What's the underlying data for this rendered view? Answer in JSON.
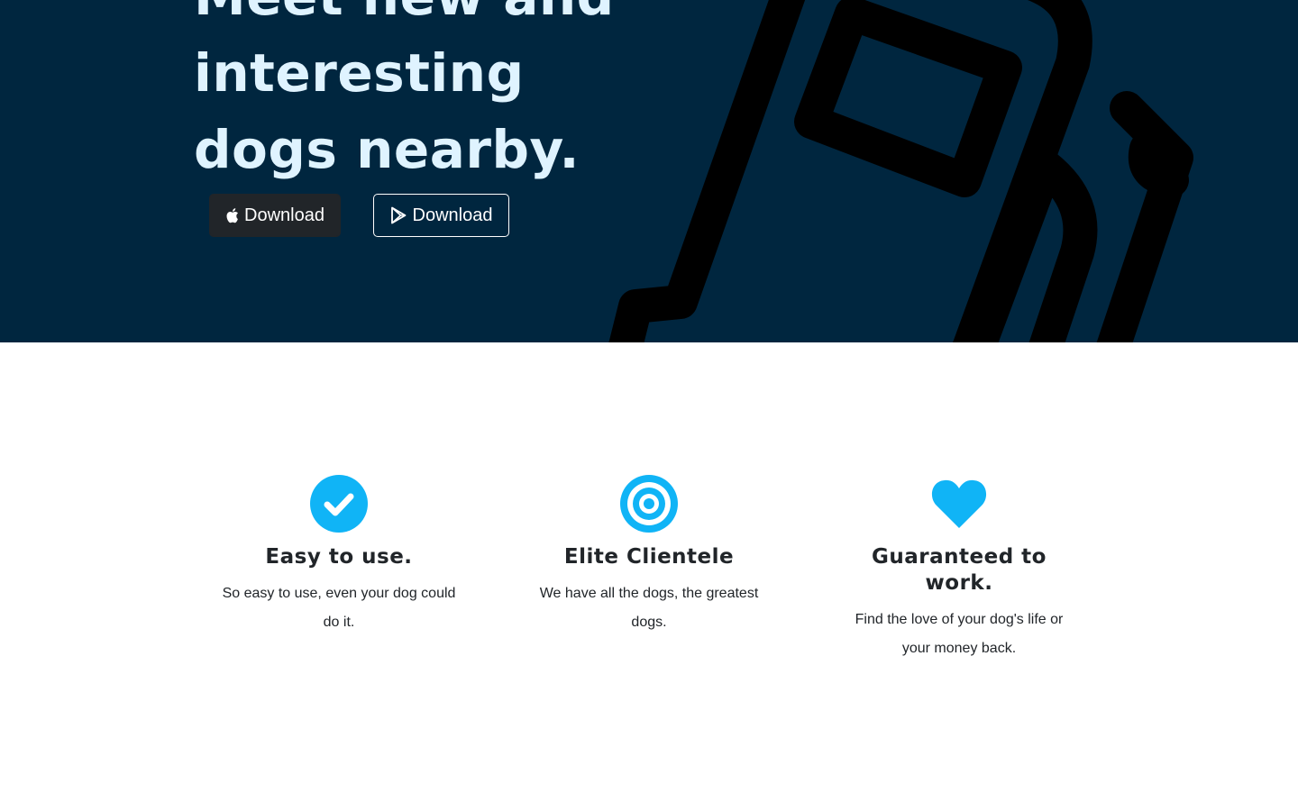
{
  "hero": {
    "headline_lines": [
      "Meet new and",
      "interesting",
      "dogs nearby."
    ],
    "apple_button": {
      "label": "Download",
      "icon": "apple-icon"
    },
    "play_button": {
      "label": "Download",
      "icon": "google-play-icon"
    },
    "background_color": "#00263f",
    "headline_color": "#dff3ff",
    "illustration": "phone-outline-illustration"
  },
  "features": [
    {
      "icon": "check-circle-icon",
      "title": "Easy to use.",
      "text": "So easy to use, even your dog could do it."
    },
    {
      "icon": "bullseye-icon",
      "title": "Elite Clientele",
      "text": "We have all the dogs, the greatest dogs."
    },
    {
      "icon": "heart-icon",
      "title": "Guaranteed to work.",
      "text": "Find the love of your dog's life or your money back."
    }
  ],
  "colors": {
    "accent": "#10b4f6",
    "text": "#212529",
    "dark_button": "#212529"
  }
}
